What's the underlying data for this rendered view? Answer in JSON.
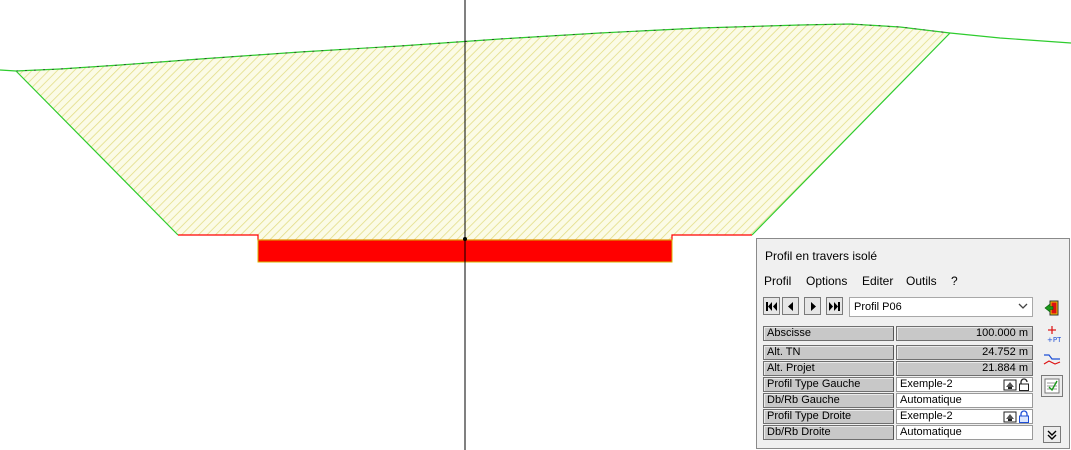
{
  "panel": {
    "title": "Profil en travers isolé",
    "menu": [
      "Profil",
      "Options",
      "Editer",
      "Outils",
      "?"
    ],
    "profile_selected": "Profil P06",
    "fields": [
      {
        "label": "Abscisse",
        "value": "100.000 m",
        "editable": false
      },
      {
        "label": "Alt. TN",
        "value": "24.752 m",
        "editable": false
      },
      {
        "label": "Alt. Projet",
        "value": "21.884 m",
        "editable": false
      },
      {
        "label": "Profil Type Gauche",
        "value": "Exemple-2",
        "editable": true
      },
      {
        "label": "Db/Rb Gauche",
        "value": "Automatique",
        "editable": true
      },
      {
        "label": "Profil Type Droite",
        "value": "Exemple-2",
        "editable": true
      },
      {
        "label": "Db/Rb Droite",
        "value": "Automatique",
        "editable": true
      }
    ]
  },
  "colors": {
    "terrain_line": "#2ecc2e",
    "cut_fill": "#e8e89c",
    "project_line": "#ff0000",
    "pavement": "#ff0000",
    "axis_line": "#000000"
  },
  "icons": [
    "first-icon",
    "previous-icon",
    "next-icon",
    "last-icon",
    "exit-icon",
    "insert-point-icon",
    "profile-edit-icon",
    "checklist-icon",
    "expand-down-icon",
    "settings-icon",
    "lock-icon"
  ]
}
